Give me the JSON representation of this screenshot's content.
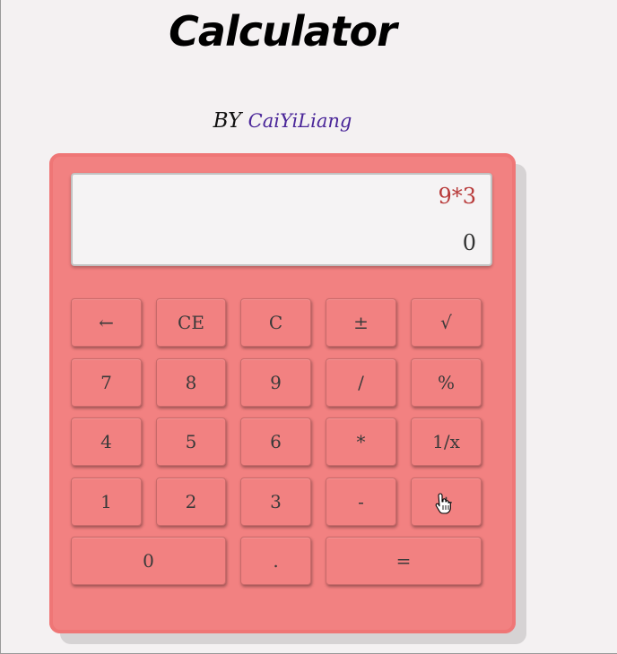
{
  "header": {
    "title": "Calculator",
    "by_prefix": "BY",
    "author": "CaiYiLiang"
  },
  "display": {
    "expression": "9*3",
    "result": "0"
  },
  "keys": {
    "backspace": "←",
    "ce": "CE",
    "c": "C",
    "plus_minus": "±",
    "sqrt": "√",
    "k7": "7",
    "k8": "8",
    "k9": "9",
    "divide": "/",
    "percent": "%",
    "k4": "4",
    "k5": "5",
    "k6": "6",
    "multiply": "*",
    "reciprocal": "1/x",
    "k1": "1",
    "k2": "2",
    "k3": "3",
    "minus": "-",
    "plus": "+",
    "k0": "0",
    "dot": ".",
    "equals": "="
  },
  "colors": {
    "calculator_body": "#f28181",
    "display_bg": "#f5f3f4",
    "expression_text": "#b83a3a",
    "author_text": "#4a2699"
  }
}
